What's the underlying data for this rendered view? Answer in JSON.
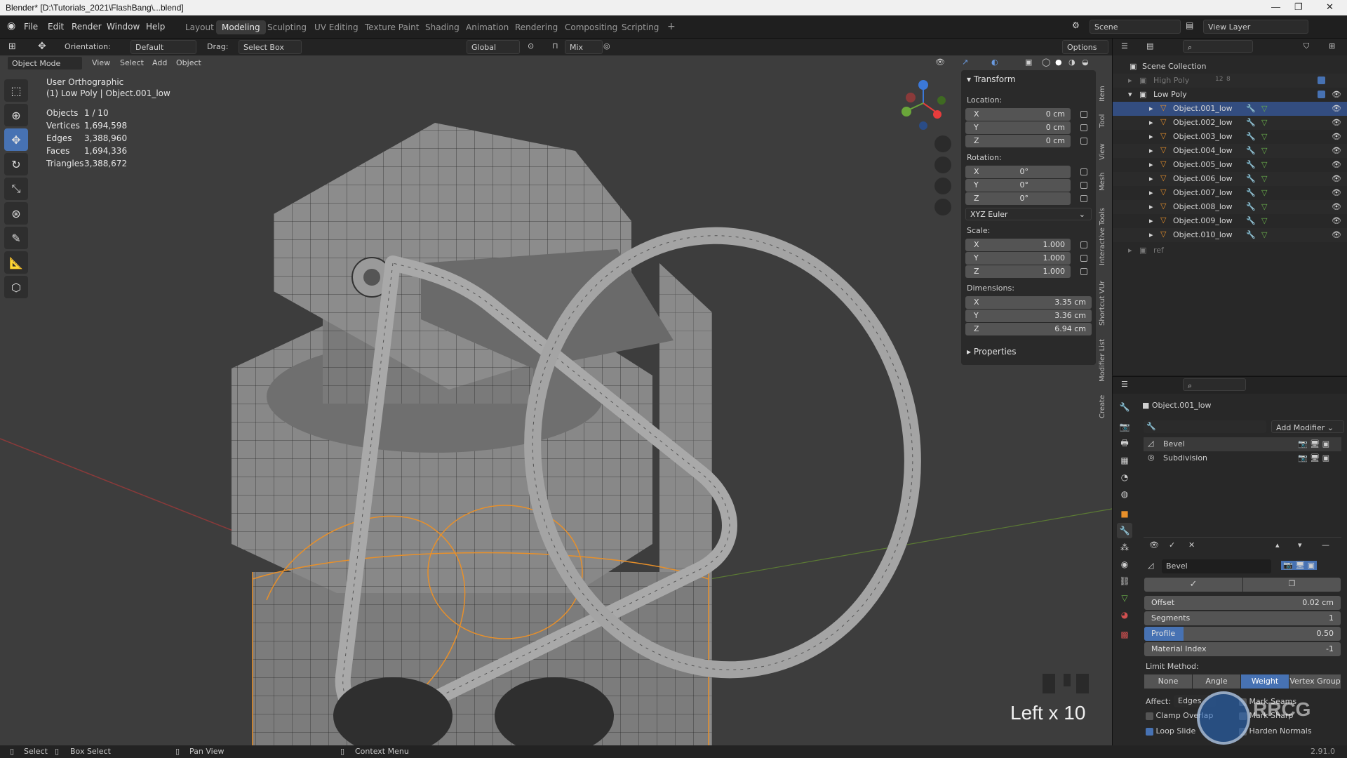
{
  "window": {
    "title": "Blender* [D:\\Tutorials_2021\\FlashBang\\...blend]"
  },
  "menu": [
    "File",
    "Edit",
    "Render",
    "Window",
    "Help"
  ],
  "workspaces": [
    "Layout",
    "Modeling",
    "Sculpting",
    "UV Editing",
    "Texture Paint",
    "Shading",
    "Animation",
    "Rendering",
    "Compositing",
    "Scripting"
  ],
  "active_workspace": "Modeling",
  "scene": "Scene",
  "view_layer": "View Layer",
  "tool_header": {
    "orientation_label": "Orientation:",
    "orientation_value": "Default",
    "drag_label": "Drag:",
    "drag_value": "Select Box",
    "transform_orientation": "Global",
    "snap": "Mix",
    "options": "Options"
  },
  "viewport_header": {
    "mode": "Object Mode",
    "menus": [
      "View",
      "Select",
      "Add",
      "Object"
    ]
  },
  "overlay": {
    "view_name": "User Orthographic",
    "context": "(1) Low Poly | Object.001_low",
    "stats": [
      {
        "label": "Objects",
        "value": "1 / 10"
      },
      {
        "label": "Vertices",
        "value": "1,694,598"
      },
      {
        "label": "Edges",
        "value": "3,388,960"
      },
      {
        "label": "Faces",
        "value": "1,694,336"
      },
      {
        "label": "Triangles",
        "value": "3,388,672"
      }
    ],
    "key_display": "Left x 10"
  },
  "npanel": {
    "transform_title": "Transform",
    "location_label": "Location:",
    "location": [
      {
        "axis": "X",
        "value": "0 cm"
      },
      {
        "axis": "Y",
        "value": "0 cm"
      },
      {
        "axis": "Z",
        "value": "0 cm"
      }
    ],
    "rotation_label": "Rotation:",
    "rotation": [
      {
        "axis": "X",
        "value": "0°"
      },
      {
        "axis": "Y",
        "value": "0°"
      },
      {
        "axis": "Z",
        "value": "0°"
      }
    ],
    "rotation_mode": "XYZ Euler",
    "scale_label": "Scale:",
    "scale": [
      {
        "axis": "X",
        "value": "1.000"
      },
      {
        "axis": "Y",
        "value": "1.000"
      },
      {
        "axis": "Z",
        "value": "1.000"
      }
    ],
    "dimensions_label": "Dimensions:",
    "dimensions": [
      {
        "axis": "X",
        "value": "3.35 cm"
      },
      {
        "axis": "Y",
        "value": "3.36 cm"
      },
      {
        "axis": "Z",
        "value": "6.94 cm"
      }
    ],
    "properties_title": "Properties",
    "tabs": [
      "Item",
      "Tool",
      "View",
      "Mesh",
      "Interactive Tools",
      "Shortcut VUr",
      "Modifier List",
      "Create"
    ]
  },
  "outliner": {
    "root": "Scene Collection",
    "high_poly": "High Poly",
    "high_poly_counts": [
      "12",
      "8"
    ],
    "low_poly": "Low Poly",
    "objects": [
      "Object.001_low",
      "Object.002_low",
      "Object.003_low",
      "Object.004_low",
      "Object.005_low",
      "Object.006_low",
      "Object.007_low",
      "Object.008_low",
      "Object.009_low",
      "Object.010_low"
    ],
    "ref": "ref"
  },
  "properties": {
    "object_name": "Object.001_low",
    "add_modifier": "Add Modifier",
    "modifiers": [
      "Bevel",
      "Subdivision"
    ],
    "bevel_name": "Bevel",
    "fields": [
      {
        "label": "Offset",
        "value": "0.02 cm"
      },
      {
        "label": "Segments",
        "value": "1"
      },
      {
        "label": "Profile",
        "value": "0.50"
      },
      {
        "label": "Material Index",
        "value": "-1"
      }
    ],
    "profile_fill": 0.5,
    "limit_method_label": "Limit Method:",
    "limit_methods": [
      "None",
      "Angle",
      "Weight",
      "Vertex Group"
    ],
    "limit_method_active": "Weight",
    "affect_label": "Affect:",
    "affect_value": "Edges",
    "mark_seams": "Mark Seams",
    "mark_sharp": "Mark Sharp",
    "clamp_overlap": "Clamp Overlap",
    "loop_slide": "Loop Slide",
    "harden_normals": "Harden Normals"
  },
  "statusbar": {
    "select": "Select",
    "box_select": "Box Select",
    "pan_view": "Pan View",
    "context_menu": "Context Menu",
    "version": "2.91.0"
  },
  "watermark": "RRCG",
  "colors": {
    "accent": "#4772b3",
    "selection_orange": "#e8902a",
    "viewport_bg": "#3d3d3d"
  }
}
